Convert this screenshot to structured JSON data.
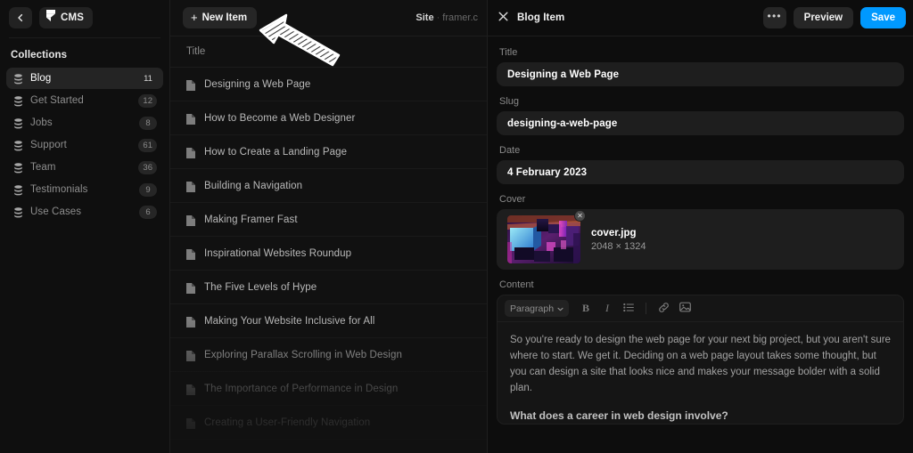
{
  "sidebar": {
    "back_icon": "chevron-left-icon",
    "app_logo_icon": "framer-logo-icon",
    "app_label": "CMS",
    "section_title": "Collections",
    "items": [
      {
        "icon": "database-icon",
        "label": "Blog",
        "count": "11",
        "active": true
      },
      {
        "icon": "database-icon",
        "label": "Get Started",
        "count": "12",
        "active": false
      },
      {
        "icon": "database-icon",
        "label": "Jobs",
        "count": "8",
        "active": false
      },
      {
        "icon": "database-icon",
        "label": "Support",
        "count": "61",
        "active": false
      },
      {
        "icon": "database-icon",
        "label": "Team",
        "count": "36",
        "active": false
      },
      {
        "icon": "database-icon",
        "label": "Testimonials",
        "count": "9",
        "active": false
      },
      {
        "icon": "database-icon",
        "label": "Use Cases",
        "count": "6",
        "active": false
      }
    ]
  },
  "list_panel": {
    "new_item_label": "New Item",
    "new_item_plus": "+",
    "site_label": "Site",
    "site_separator": "·",
    "site_value": "framer.c",
    "column_header": "Title",
    "annotation": "hand-drawn-arrow-pointing-to-new-item",
    "rows": [
      {
        "icon": "document-icon",
        "title": "Designing a Web Page"
      },
      {
        "icon": "document-icon",
        "title": "How to Become a Web Designer"
      },
      {
        "icon": "document-icon",
        "title": "How to Create a Landing Page"
      },
      {
        "icon": "document-icon",
        "title": "Building a Navigation"
      },
      {
        "icon": "document-icon",
        "title": "Making Framer Fast"
      },
      {
        "icon": "document-icon",
        "title": "Inspirational Websites Roundup"
      },
      {
        "icon": "document-icon",
        "title": "The Five Levels of Hype"
      },
      {
        "icon": "document-icon",
        "title": "Making Your Website Inclusive for All"
      },
      {
        "icon": "document-icon",
        "title": "Exploring Parallax Scrolling in Web Design"
      },
      {
        "icon": "document-icon",
        "title": "The Importance of Performance in Design"
      },
      {
        "icon": "document-icon",
        "title": "Creating a User-Friendly Navigation"
      }
    ]
  },
  "detail": {
    "close_icon": "close-x-icon",
    "title": "Blog Item",
    "more_icon": "ellipsis-icon",
    "more_label": "•••",
    "preview_label": "Preview",
    "save_label": "Save",
    "save_color": "#0099FF",
    "fields": {
      "title_label": "Title",
      "title_value": "Designing a Web Page",
      "slug_label": "Slug",
      "slug_value": "designing-a-web-page",
      "date_label": "Date",
      "date_value": "4 February 2023",
      "cover_label": "Cover",
      "cover_filename": "cover.jpg",
      "cover_dimensions": "2048 × 1324",
      "cover_remove_icon": "remove-circle-icon",
      "content_label": "Content"
    },
    "editor_toolbar": {
      "style_select": "Paragraph",
      "chevron_icon": "chevron-down-icon",
      "bold_label": "B",
      "italic_label": "I",
      "list_icon": "bullet-list-icon",
      "link_icon": "link-icon",
      "image_icon": "image-icon"
    },
    "content": {
      "paragraph": "So you're ready to design the web page for your next big project, but you aren't sure where to start. We get it. Deciding on a web page layout takes some thought, but you can design a site that looks nice and makes your message bolder with a solid plan.",
      "heading": "What does a career in web design involve?"
    }
  }
}
